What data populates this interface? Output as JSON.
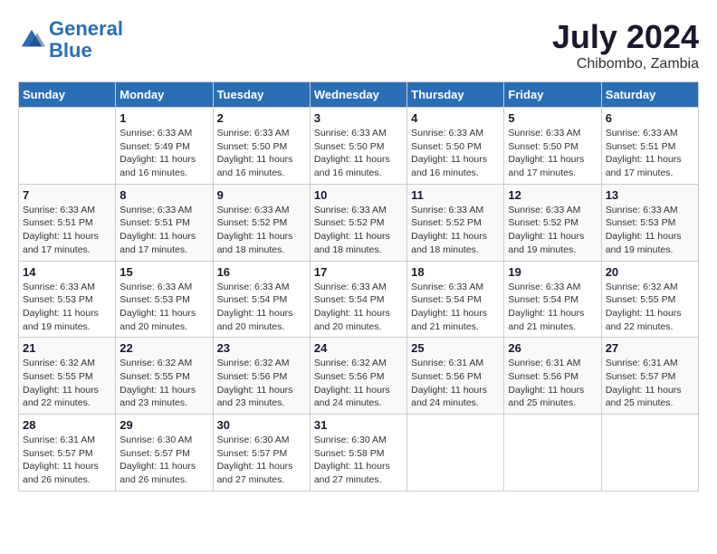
{
  "header": {
    "logo_line1": "General",
    "logo_line2": "Blue",
    "month_year": "July 2024",
    "location": "Chibombo, Zambia"
  },
  "weekdays": [
    "Sunday",
    "Monday",
    "Tuesday",
    "Wednesday",
    "Thursday",
    "Friday",
    "Saturday"
  ],
  "weeks": [
    [
      {
        "day": "",
        "info": ""
      },
      {
        "day": "1",
        "info": "Sunrise: 6:33 AM\nSunset: 5:49 PM\nDaylight: 11 hours\nand 16 minutes."
      },
      {
        "day": "2",
        "info": "Sunrise: 6:33 AM\nSunset: 5:50 PM\nDaylight: 11 hours\nand 16 minutes."
      },
      {
        "day": "3",
        "info": "Sunrise: 6:33 AM\nSunset: 5:50 PM\nDaylight: 11 hours\nand 16 minutes."
      },
      {
        "day": "4",
        "info": "Sunrise: 6:33 AM\nSunset: 5:50 PM\nDaylight: 11 hours\nand 16 minutes."
      },
      {
        "day": "5",
        "info": "Sunrise: 6:33 AM\nSunset: 5:50 PM\nDaylight: 11 hours\nand 17 minutes."
      },
      {
        "day": "6",
        "info": "Sunrise: 6:33 AM\nSunset: 5:51 PM\nDaylight: 11 hours\nand 17 minutes."
      }
    ],
    [
      {
        "day": "7",
        "info": "Sunrise: 6:33 AM\nSunset: 5:51 PM\nDaylight: 11 hours\nand 17 minutes."
      },
      {
        "day": "8",
        "info": "Sunrise: 6:33 AM\nSunset: 5:51 PM\nDaylight: 11 hours\nand 17 minutes."
      },
      {
        "day": "9",
        "info": "Sunrise: 6:33 AM\nSunset: 5:52 PM\nDaylight: 11 hours\nand 18 minutes."
      },
      {
        "day": "10",
        "info": "Sunrise: 6:33 AM\nSunset: 5:52 PM\nDaylight: 11 hours\nand 18 minutes."
      },
      {
        "day": "11",
        "info": "Sunrise: 6:33 AM\nSunset: 5:52 PM\nDaylight: 11 hours\nand 18 minutes."
      },
      {
        "day": "12",
        "info": "Sunrise: 6:33 AM\nSunset: 5:52 PM\nDaylight: 11 hours\nand 19 minutes."
      },
      {
        "day": "13",
        "info": "Sunrise: 6:33 AM\nSunset: 5:53 PM\nDaylight: 11 hours\nand 19 minutes."
      }
    ],
    [
      {
        "day": "14",
        "info": "Sunrise: 6:33 AM\nSunset: 5:53 PM\nDaylight: 11 hours\nand 19 minutes."
      },
      {
        "day": "15",
        "info": "Sunrise: 6:33 AM\nSunset: 5:53 PM\nDaylight: 11 hours\nand 20 minutes."
      },
      {
        "day": "16",
        "info": "Sunrise: 6:33 AM\nSunset: 5:54 PM\nDaylight: 11 hours\nand 20 minutes."
      },
      {
        "day": "17",
        "info": "Sunrise: 6:33 AM\nSunset: 5:54 PM\nDaylight: 11 hours\nand 20 minutes."
      },
      {
        "day": "18",
        "info": "Sunrise: 6:33 AM\nSunset: 5:54 PM\nDaylight: 11 hours\nand 21 minutes."
      },
      {
        "day": "19",
        "info": "Sunrise: 6:33 AM\nSunset: 5:54 PM\nDaylight: 11 hours\nand 21 minutes."
      },
      {
        "day": "20",
        "info": "Sunrise: 6:32 AM\nSunset: 5:55 PM\nDaylight: 11 hours\nand 22 minutes."
      }
    ],
    [
      {
        "day": "21",
        "info": "Sunrise: 6:32 AM\nSunset: 5:55 PM\nDaylight: 11 hours\nand 22 minutes."
      },
      {
        "day": "22",
        "info": "Sunrise: 6:32 AM\nSunset: 5:55 PM\nDaylight: 11 hours\nand 23 minutes."
      },
      {
        "day": "23",
        "info": "Sunrise: 6:32 AM\nSunset: 5:56 PM\nDaylight: 11 hours\nand 23 minutes."
      },
      {
        "day": "24",
        "info": "Sunrise: 6:32 AM\nSunset: 5:56 PM\nDaylight: 11 hours\nand 24 minutes."
      },
      {
        "day": "25",
        "info": "Sunrise: 6:31 AM\nSunset: 5:56 PM\nDaylight: 11 hours\nand 24 minutes."
      },
      {
        "day": "26",
        "info": "Sunrise: 6:31 AM\nSunset: 5:56 PM\nDaylight: 11 hours\nand 25 minutes."
      },
      {
        "day": "27",
        "info": "Sunrise: 6:31 AM\nSunset: 5:57 PM\nDaylight: 11 hours\nand 25 minutes."
      }
    ],
    [
      {
        "day": "28",
        "info": "Sunrise: 6:31 AM\nSunset: 5:57 PM\nDaylight: 11 hours\nand 26 minutes."
      },
      {
        "day": "29",
        "info": "Sunrise: 6:30 AM\nSunset: 5:57 PM\nDaylight: 11 hours\nand 26 minutes."
      },
      {
        "day": "30",
        "info": "Sunrise: 6:30 AM\nSunset: 5:57 PM\nDaylight: 11 hours\nand 27 minutes."
      },
      {
        "day": "31",
        "info": "Sunrise: 6:30 AM\nSunset: 5:58 PM\nDaylight: 11 hours\nand 27 minutes."
      },
      {
        "day": "",
        "info": ""
      },
      {
        "day": "",
        "info": ""
      },
      {
        "day": "",
        "info": ""
      }
    ]
  ]
}
